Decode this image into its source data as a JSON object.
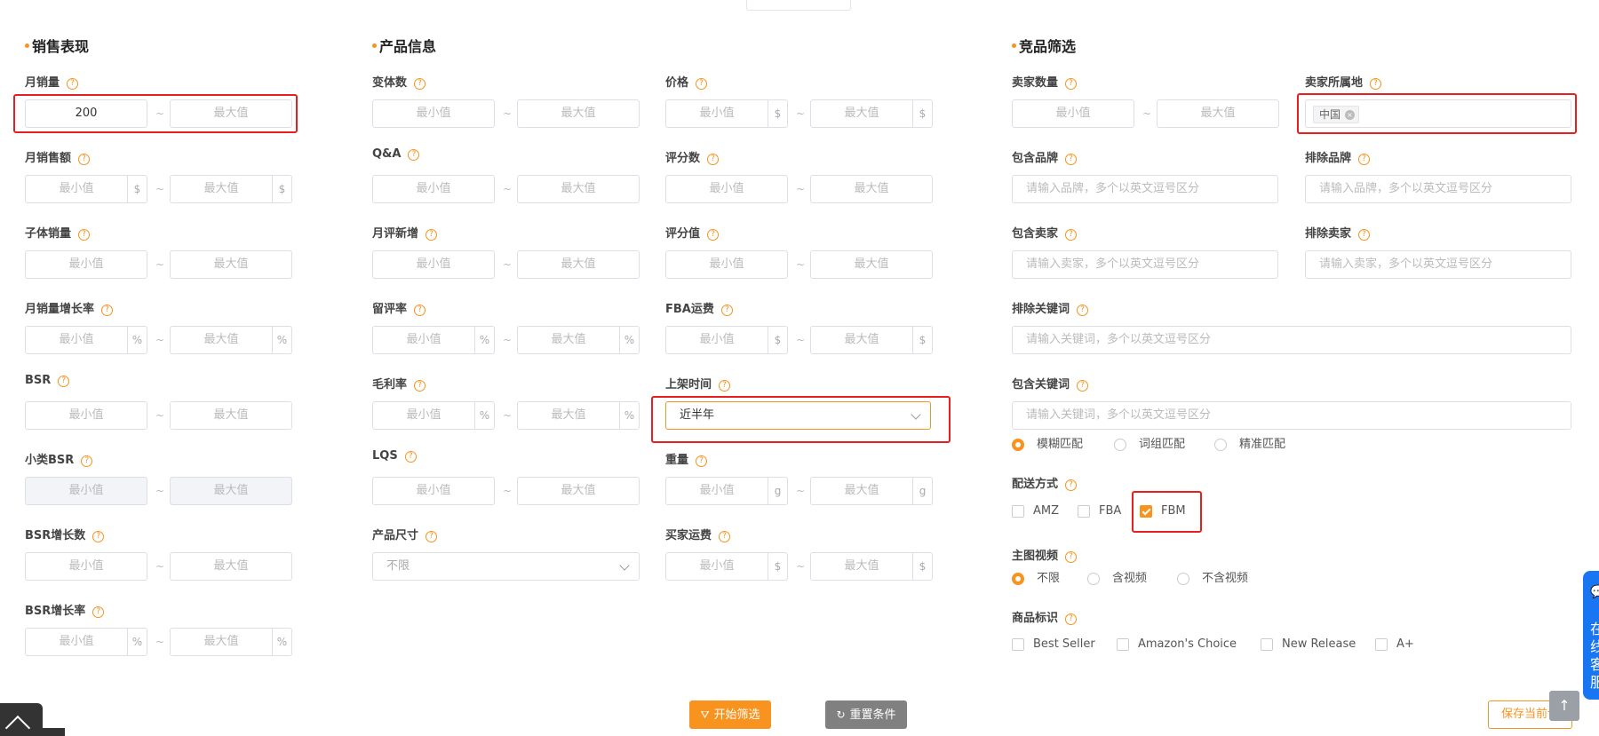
{
  "sales": {
    "title": "销售表现",
    "monthly_sales": {
      "label": "月销量",
      "min_value": "200",
      "max_placeholder": "最大值"
    },
    "monthly_revenue": {
      "label": "月销售额",
      "min_placeholder": "最小值",
      "max_placeholder": "最大值",
      "unit": "$"
    },
    "child_sales": {
      "label": "子体销量",
      "min_placeholder": "最小值",
      "max_placeholder": "最大值"
    },
    "sales_growth": {
      "label": "月销量增长率",
      "min_placeholder": "最小值",
      "max_placeholder": "最大值",
      "unit": "%"
    },
    "bsr": {
      "label": "BSR",
      "min_placeholder": "最小值",
      "max_placeholder": "最大值"
    },
    "sub_bsr": {
      "label": "小类BSR",
      "min_placeholder": "最小值",
      "max_placeholder": "最大值"
    },
    "bsr_growth_count": {
      "label": "BSR增长数",
      "min_placeholder": "最小值",
      "max_placeholder": "最大值"
    },
    "bsr_growth_rate": {
      "label": "BSR增长率",
      "min_placeholder": "最小值",
      "max_placeholder": "最大值",
      "unit": "%"
    }
  },
  "product": {
    "title": "产品信息",
    "variants": {
      "label": "变体数",
      "min_placeholder": "最小值",
      "max_placeholder": "最大值"
    },
    "qa": {
      "label": "Q&A",
      "min_placeholder": "最小值",
      "max_placeholder": "最大值"
    },
    "new_reviews": {
      "label": "月评新增",
      "min_placeholder": "最小值",
      "max_placeholder": "最大值"
    },
    "review_rate": {
      "label": "留评率",
      "min_placeholder": "最小值",
      "max_placeholder": "最大值",
      "unit": "%"
    },
    "gross_margin": {
      "label": "毛利率",
      "min_placeholder": "最小值",
      "max_placeholder": "最大值",
      "unit": "%"
    },
    "lqs": {
      "label": "LQS",
      "min_placeholder": "最小值",
      "max_placeholder": "最大值"
    },
    "size": {
      "label": "产品尺寸",
      "value": "不限"
    },
    "price": {
      "label": "价格",
      "min_placeholder": "最小值",
      "max_placeholder": "最大值",
      "unit": "$"
    },
    "ratings_count": {
      "label": "评分数",
      "min_placeholder": "最小值",
      "max_placeholder": "最大值"
    },
    "rating": {
      "label": "评分值",
      "min_placeholder": "最小值",
      "max_placeholder": "最大值"
    },
    "fba_fee": {
      "label": "FBA运费",
      "min_placeholder": "最小值",
      "max_placeholder": "最大值",
      "unit": "$"
    },
    "listing_time": {
      "label": "上架时间",
      "value": "近半年"
    },
    "weight": {
      "label": "重量",
      "min_placeholder": "最小值",
      "max_placeholder": "最大值",
      "unit": "g"
    },
    "buyer_shipping": {
      "label": "买家运费",
      "min_placeholder": "最小值",
      "max_placeholder": "最大值",
      "unit": "$"
    }
  },
  "competition": {
    "title": "竞品筛选",
    "seller_count": {
      "label": "卖家数量",
      "min_placeholder": "最小值",
      "max_placeholder": "最大值"
    },
    "seller_location": {
      "label": "卖家所属地",
      "tag": "中国"
    },
    "include_brand": {
      "label": "包含品牌",
      "placeholder": "请输入品牌，多个以英文逗号区分"
    },
    "exclude_brand": {
      "label": "排除品牌",
      "placeholder": "请输入品牌，多个以英文逗号区分"
    },
    "include_seller": {
      "label": "包含卖家",
      "placeholder": "请输入卖家，多个以英文逗号区分"
    },
    "exclude_seller": {
      "label": "排除卖家",
      "placeholder": "请输入卖家，多个以英文逗号区分"
    },
    "exclude_keyword": {
      "label": "排除关键词",
      "placeholder": "请输入关键词，多个以英文逗号区分"
    },
    "include_keyword": {
      "label": "包含关键词",
      "placeholder": "请输入关键词，多个以英文逗号区分"
    },
    "match_options": [
      "模糊匹配",
      "词组匹配",
      "精准匹配"
    ],
    "match_selected": 0,
    "delivery": {
      "label": "配送方式",
      "options": [
        "AMZ",
        "FBA",
        "FBM"
      ],
      "checked": [
        false,
        false,
        true
      ]
    },
    "main_video": {
      "label": "主图视频",
      "options": [
        "不限",
        "含视频",
        "不含视频"
      ],
      "selected": 0
    },
    "badges": {
      "label": "商品标识",
      "options": [
        "Best Seller",
        "Amazon's Choice",
        "New Release",
        "A+"
      ]
    }
  },
  "actions": {
    "start": "开始筛选",
    "reset": "重置条件",
    "save": "保存当前专"
  },
  "side_tab": {
    "text": "在线客服"
  },
  "help_glyph": "?",
  "tilde": "~",
  "colors": {
    "accent": "#f7931e",
    "highlight": "#e62020",
    "side_tab": "#1976f2"
  }
}
